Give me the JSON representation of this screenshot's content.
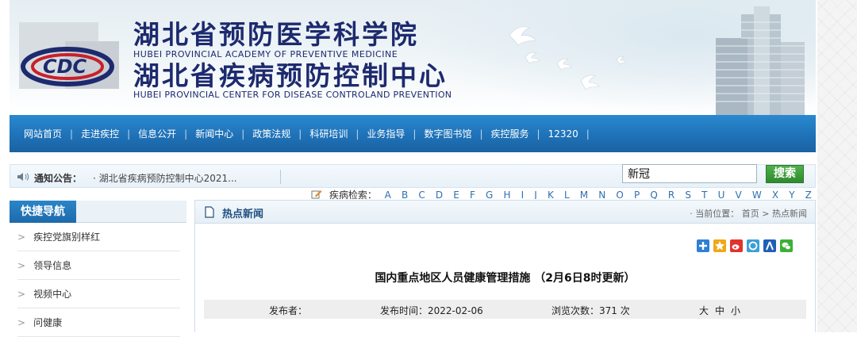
{
  "header": {
    "title_cn_1": "湖北省预防医学科学院",
    "title_en_1": "HUBEI PROVINCIAL ACADEMY OF PREVENTIVE MEDICINE",
    "title_cn_2": "湖北省疾病预防控制中心",
    "title_en_2": "HUBEI PROVINCIAL CENTER FOR DISEASE CONTROLAND PREVENTION"
  },
  "nav": {
    "items": [
      {
        "label": "网站首页"
      },
      {
        "label": "走进疾控"
      },
      {
        "label": "信息公开"
      },
      {
        "label": "新闻中心"
      },
      {
        "label": "政策法规"
      },
      {
        "label": "科研培训"
      },
      {
        "label": "业务指导"
      },
      {
        "label": "数字图书馆"
      },
      {
        "label": "疾控服务"
      },
      {
        "label": "12320"
      }
    ]
  },
  "notice": {
    "label": "通知公告：",
    "text": "· 湖北省疾病预防控制中心2021..."
  },
  "search": {
    "value": "新冠",
    "button_label": "搜索"
  },
  "disease_search": {
    "label": "疾病检索：",
    "letters": [
      "A",
      "B",
      "C",
      "D",
      "E",
      "F",
      "G",
      "H",
      "I",
      "J",
      "K",
      "L",
      "M",
      "N",
      "O",
      "P",
      "Q",
      "R",
      "S",
      "T",
      "U",
      "V",
      "W",
      "X",
      "Y",
      "Z"
    ]
  },
  "sidebar": {
    "title": "快捷导航",
    "items": [
      {
        "label": "疾控党旗别样红"
      },
      {
        "label": "领导信息"
      },
      {
        "label": "视频中心"
      },
      {
        "label": "问健康"
      }
    ]
  },
  "content": {
    "section_title": "热点新闻",
    "breadcrumb_prefix": "· 当前位置：",
    "breadcrumb_home": "首页",
    "breadcrumb_sep": ">",
    "breadcrumb_current": "热点新闻",
    "article_title": "国内重点地区人员健康管理措施  （2月6日8时更新）",
    "publisher_label": "发布者：",
    "publish_time": "发布时间：2022-02-06",
    "views": "浏览次数：371 次",
    "font_sizes": [
      "大",
      "中",
      "小"
    ]
  },
  "share_icons": [
    {
      "name": "share-plus-icon",
      "color": "#2e7fd6"
    },
    {
      "name": "share-star-icon",
      "color": "#f0a818"
    },
    {
      "name": "share-weibo-icon",
      "color": "#e2322d"
    },
    {
      "name": "share-qzone-icon",
      "color": "#3aa0d8"
    },
    {
      "name": "share-renren-icon",
      "color": "#1f5fb8"
    },
    {
      "name": "share-wechat-icon",
      "color": "#3cb035"
    }
  ],
  "colors": {
    "nav_blue": "#1f72b8",
    "title_navy": "#1d2a6e",
    "search_green": "#3a9a36"
  }
}
